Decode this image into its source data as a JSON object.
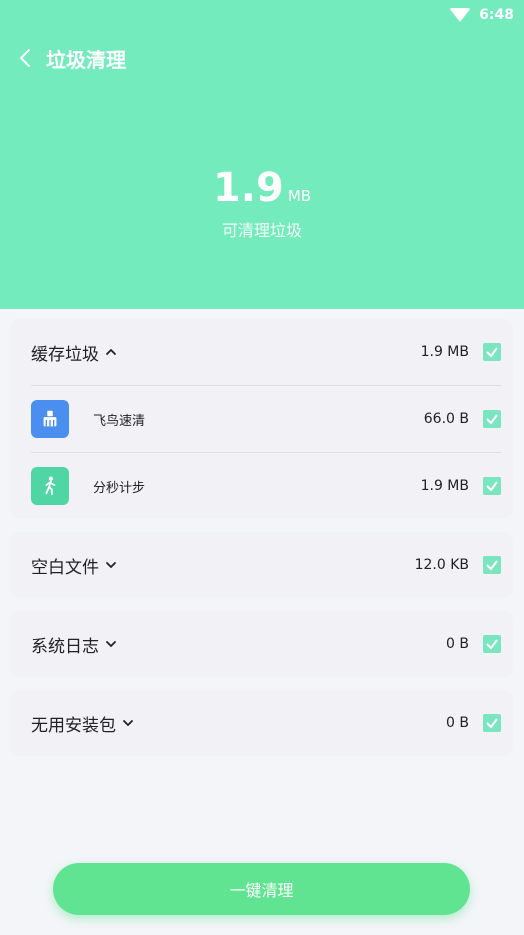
{
  "status": {
    "time": "6:48"
  },
  "topbar": {
    "title": "垃圾清理"
  },
  "summary": {
    "value": "1.9",
    "unit": "MB",
    "label": "可清理垃圾"
  },
  "categories": [
    {
      "name": "缓存垃圾",
      "size": "1.9 MB",
      "expanded": true,
      "checked": true,
      "apps": [
        {
          "name": "飞鸟速清",
          "size": "66.0 B",
          "icon": "broom-icon",
          "color": "#4a8ff0",
          "checked": true
        },
        {
          "name": "分秒计步",
          "size": "1.9 MB",
          "icon": "walking-icon",
          "color": "#4fd6a4",
          "checked": true
        }
      ]
    },
    {
      "name": "空白文件",
      "size": "12.0 KB",
      "expanded": false,
      "checked": true
    },
    {
      "name": "系统日志",
      "size": "0 B",
      "expanded": false,
      "checked": true
    },
    {
      "name": "无用安装包",
      "size": "0 B",
      "expanded": false,
      "checked": true
    }
  ],
  "button": {
    "label": "一键清理"
  },
  "colors": {
    "header": "#73ebbd",
    "check": "#7be5c0",
    "button": "#60e492"
  }
}
